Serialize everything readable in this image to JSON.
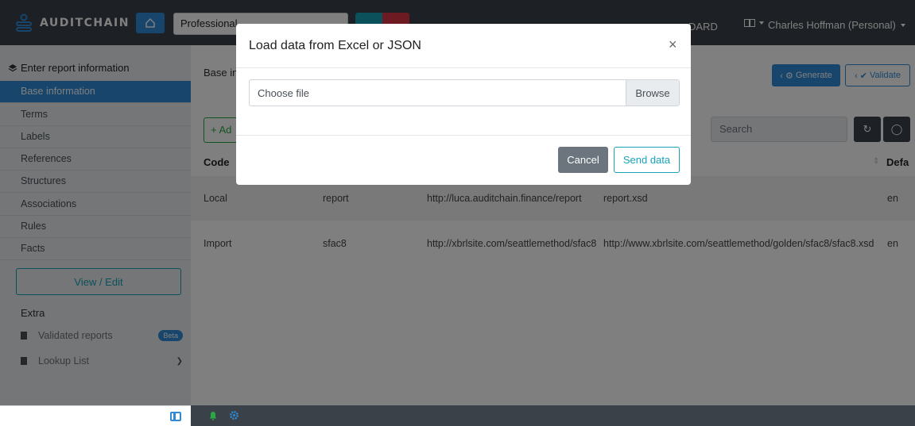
{
  "topbar": {
    "brand": "AUDITCHAIN",
    "project": "Professional",
    "nav_partial": "DARD",
    "user": "Charles Hoffman (Personal)"
  },
  "sidebar": {
    "header": "Enter report information",
    "items": [
      {
        "label": "Base information",
        "active": true
      },
      {
        "label": "Terms"
      },
      {
        "label": "Labels"
      },
      {
        "label": "References"
      },
      {
        "label": "Structures"
      },
      {
        "label": "Associations"
      },
      {
        "label": "Rules"
      },
      {
        "label": "Facts"
      }
    ],
    "view_edit": "View / Edit",
    "extra_label": "Extra",
    "extra_items": [
      {
        "label": "Validated reports",
        "badge": "Beta"
      },
      {
        "label": "Lookup List"
      }
    ]
  },
  "main": {
    "breadcrumb": "Base in",
    "generate_label": "Generate",
    "validate_label": "Validate",
    "add_label": "Ad",
    "search_placeholder": "Search",
    "columns": {
      "code": "Code",
      "default": "Defa"
    },
    "rows": [
      {
        "code": "Local",
        "prefix": "report",
        "namespace": "http://luca.auditchain.finance/report",
        "location": "report.xsd",
        "lang": "en"
      },
      {
        "code": "Import",
        "prefix": "sfac8",
        "namespace": "http://xbrlsite.com/seattlemethod/sfac8",
        "location": "http://www.xbrlsite.com/seattlemethod/golden/sfac8/sfac8.xsd",
        "lang": "en"
      }
    ]
  },
  "modal": {
    "title": "Load data from Excel or JSON",
    "close": "×",
    "file_placeholder": "Choose file",
    "browse": "Browse",
    "cancel": "Cancel",
    "send": "Send data"
  },
  "colors": {
    "navbar": "#3a4149",
    "primary": "#2f8bd6",
    "info": "#17a2b8",
    "success": "#28a745",
    "danger": "#dc3545",
    "secondary": "#6c757d"
  }
}
